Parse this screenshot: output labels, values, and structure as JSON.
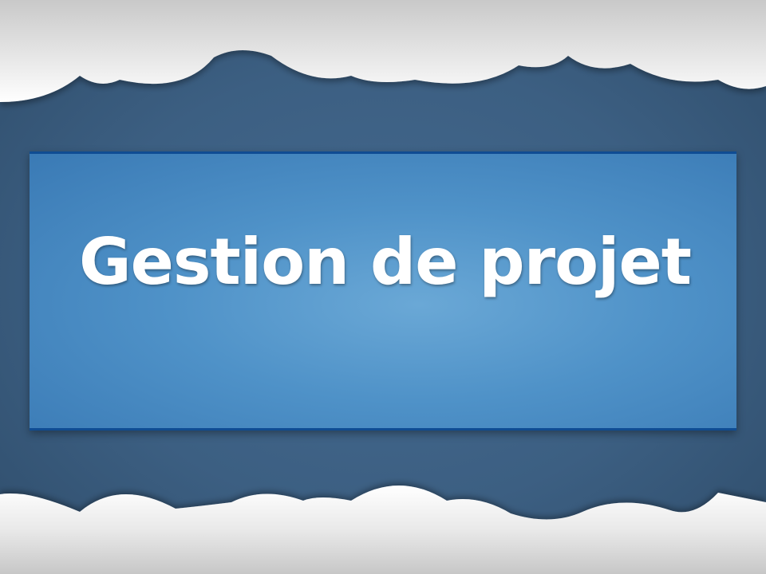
{
  "slide": {
    "title": "Gestion de projet"
  },
  "theme": {
    "background": "#3c5f82",
    "panel": "#4f92c8",
    "panel_border": "#0f4c93",
    "title_color": "#ffffff",
    "cloud_color": "#f4f4f4"
  }
}
